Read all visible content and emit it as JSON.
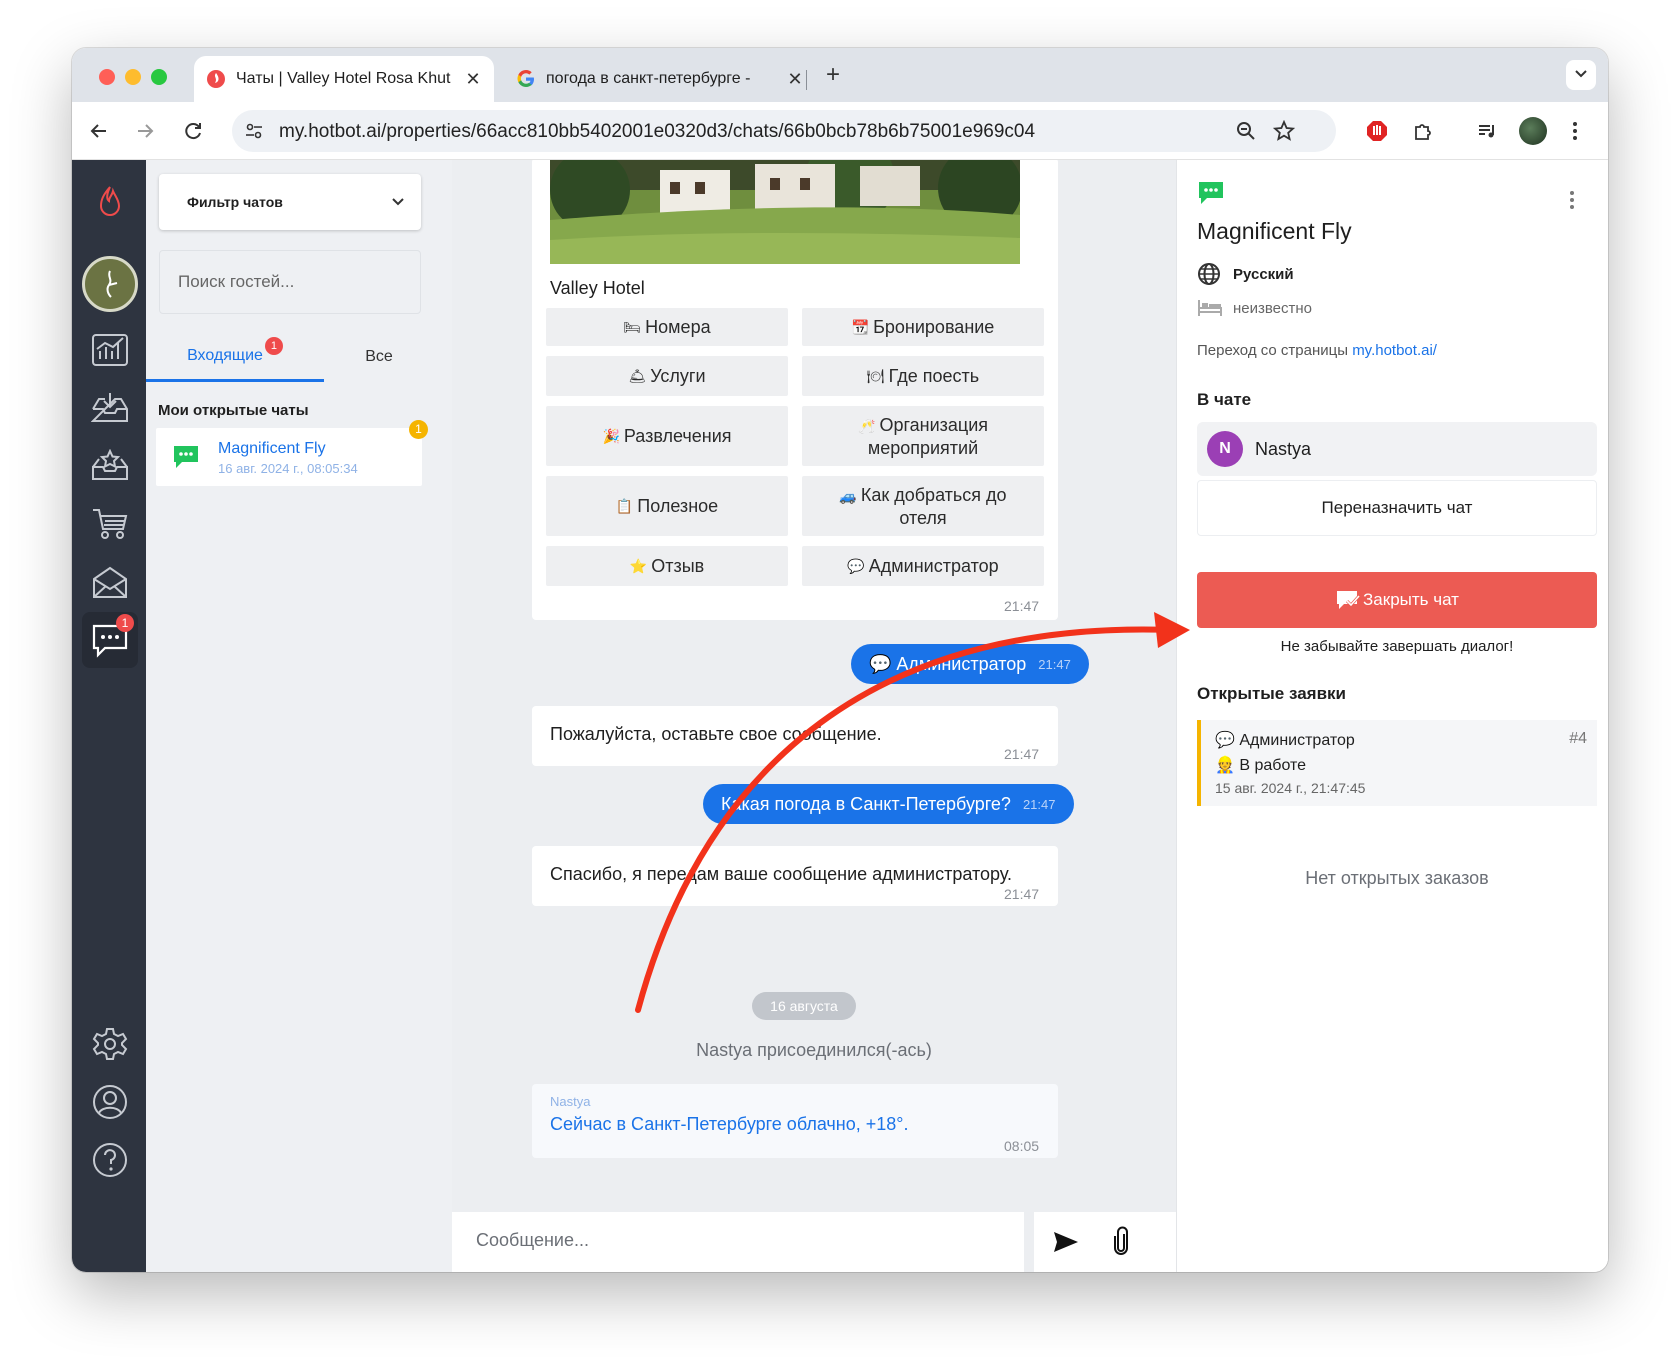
{
  "browser": {
    "tabs": [
      {
        "title": "Чаты | Valley Hotel Rosa Khut",
        "active": true
      },
      {
        "title": "погода в санкт-петербурге -",
        "active": false
      }
    ],
    "url": "my.hotbot.ai/properties/66acc810bb5402001e0320d3/chats/66b0bcb78b6b75001e969c04"
  },
  "rail": {
    "chat_badge": "1",
    "items": [
      "flame-icon",
      "analytics-icon",
      "inbox-icon",
      "reviews-icon",
      "cart-icon",
      "mail-icon",
      "chat-icon",
      "settings-icon",
      "account-icon",
      "help-icon"
    ]
  },
  "left": {
    "filter_label": "Фильтр чатов",
    "search_placeholder": "Поиск гостей...",
    "tab_incoming": "Входящие",
    "tab_incoming_badge": "1",
    "tab_all": "Все",
    "section_title": "Мои открытые чаты",
    "chat": {
      "name": "Magnificent Fly",
      "date": "16 авг. 2024 г., 08:05:34",
      "badge": "1"
    }
  },
  "chat": {
    "hotel_name": "Valley Hotel",
    "menu": [
      {
        "emoji": "🛏",
        "label": "Номера"
      },
      {
        "emoji": "📆",
        "label": "Бронирование"
      },
      {
        "emoji": "🛎",
        "label": "Услуги"
      },
      {
        "emoji": "🍽",
        "label": "Где поесть"
      },
      {
        "emoji": "🎉",
        "label": "Развлечения"
      },
      {
        "emoji": "🥂",
        "label": "Организация мероприятий"
      },
      {
        "emoji": "📋",
        "label": "Полезное"
      },
      {
        "emoji": "🚙",
        "label": "Как добраться до отеля"
      },
      {
        "emoji": "⭐",
        "label": "Отзыв"
      },
      {
        "emoji": "💬",
        "label": "Администратор"
      }
    ],
    "menu_time": "21:47",
    "out1": {
      "text": "💬 Администратор",
      "time": "21:47"
    },
    "in1": {
      "text": "Пожалуйста, оставьте свое сообщение.",
      "time": "21:47"
    },
    "out2": {
      "text": "Какая погода в Санкт-Петербурге?",
      "time": "21:47"
    },
    "in2": {
      "text": "Спасибо, я передам ваше сообщение администратору.",
      "time": "21:47"
    },
    "date_divider": "16 августа",
    "joined": "Nastya присоединился(-ась)",
    "agent_msg": {
      "author": "Nastya",
      "text": "Сейчас в Санкт-Петербурге облачно, +18°.",
      "time": "08:05"
    },
    "composer_placeholder": "Сообщение..."
  },
  "right": {
    "guest_name": "Magnificent Fly",
    "language": "Русский",
    "room": "неизвестно",
    "ref_prefix": "Переход со страницы",
    "ref_link": "my.hotbot.ai/",
    "in_chat_title": "В чате",
    "agent_initial": "N",
    "agent_name": "Nastya",
    "reassign_label": "Переназначить чат",
    "close_label": "Закрыть чат",
    "close_hint": "Не забывайте завершать диалог!",
    "tickets_title": "Открытые заявки",
    "ticket": {
      "type": "💬 Администратор",
      "number": "#4",
      "status": "👷 В работе",
      "date": "15 авг. 2024 г., 21:47:45"
    },
    "no_orders": "Нет открытых заказов"
  },
  "colors": {
    "accent": "#1a73e8",
    "close": "#ec5b53",
    "annotation_arrow": "#f2321b",
    "rail": "#2e3440"
  }
}
